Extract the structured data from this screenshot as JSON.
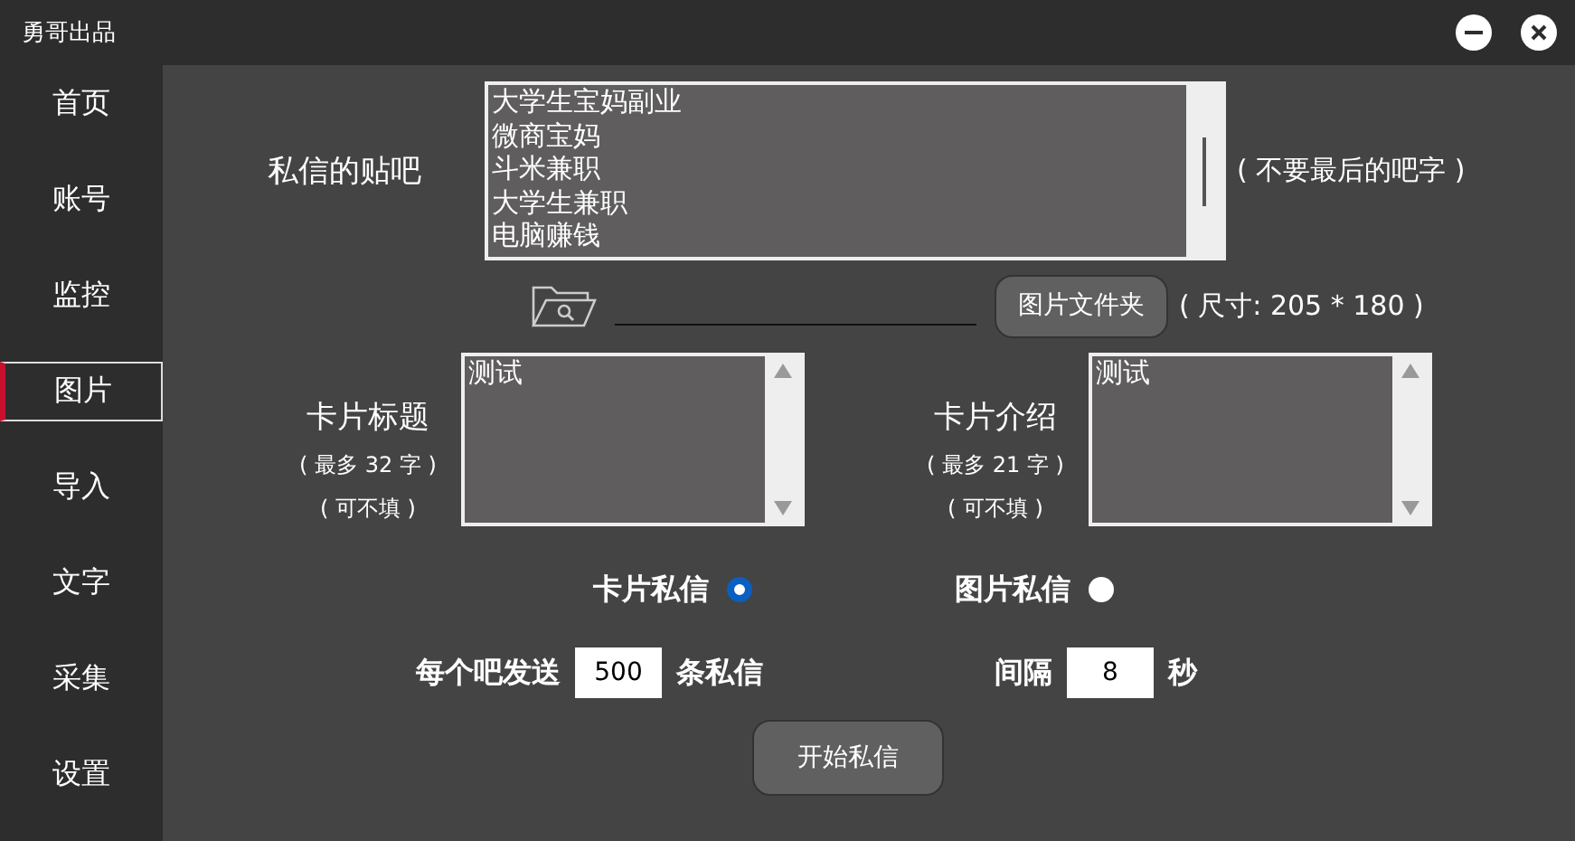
{
  "window": {
    "title": "勇哥出品"
  },
  "sidebar": {
    "items": [
      {
        "label": "首页",
        "selected": false
      },
      {
        "label": "账号",
        "selected": false
      },
      {
        "label": "监控",
        "selected": false
      },
      {
        "label": "图片",
        "selected": true
      },
      {
        "label": "导入",
        "selected": false
      },
      {
        "label": "文字",
        "selected": false
      },
      {
        "label": "采集",
        "selected": false
      },
      {
        "label": "设置",
        "selected": false
      }
    ]
  },
  "forums": {
    "label": "私信的贴吧",
    "items": [
      "大学生宝妈副业",
      "微商宝妈",
      "斗米兼职",
      "大学生兼职",
      "电脑赚钱"
    ],
    "note": "( 不要最后的吧字 )"
  },
  "image_folder": {
    "button": "图片文件夹",
    "note": "( 尺寸: 205 * 180 )"
  },
  "card_fields": [
    {
      "label": "卡片标题",
      "limit": "( 最多 32 字 )",
      "optional": "( 可不填 )",
      "value": "测试"
    },
    {
      "label": "卡片介绍",
      "limit": "( 最多 21 字 )",
      "optional": "( 可不填 )",
      "value": "测试"
    }
  ],
  "modes": [
    {
      "label": "卡片私信",
      "selected": true
    },
    {
      "label": "图片私信",
      "selected": false
    }
  ],
  "send": {
    "per_forum_label": "每个吧发送",
    "per_forum_value": "500",
    "per_forum_unit": "条私信",
    "interval_label": "间隔",
    "interval_value": "8",
    "interval_unit": "秒"
  },
  "start_button": "开始私信"
}
